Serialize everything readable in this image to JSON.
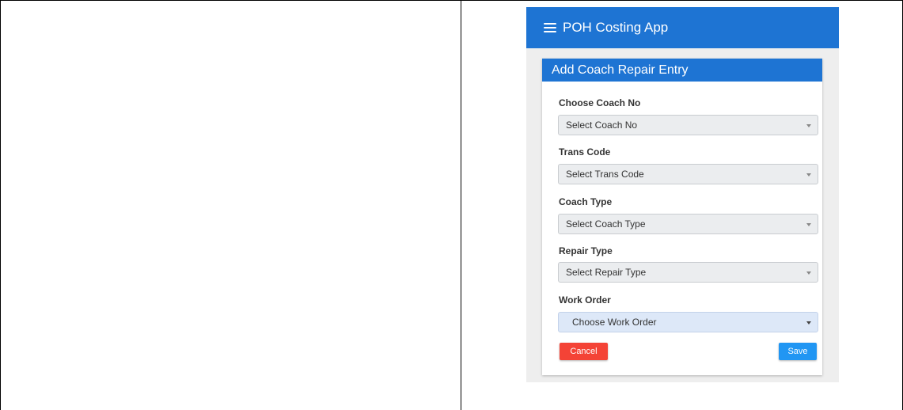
{
  "app": {
    "title": "POH Costing App"
  },
  "card": {
    "title": "Add Coach Repair Entry"
  },
  "fields": [
    {
      "label": "Choose Coach No",
      "placeholder": "Select Coach No"
    },
    {
      "label": "Trans Code",
      "placeholder": "Select Trans Code"
    },
    {
      "label": "Coach Type",
      "placeholder": "Select Coach Type"
    },
    {
      "label": "Repair Type",
      "placeholder": "Select Repair Type"
    },
    {
      "label": "Work Order",
      "placeholder": "Choose Work Order"
    }
  ],
  "buttons": {
    "cancel": "Cancel",
    "save": "Save"
  },
  "colors": {
    "appbar": "#1e74d3",
    "cancel": "#f44336",
    "save": "#2196f3"
  },
  "icons": {
    "menu": "menu-icon",
    "dropdown": "chevron-down-icon"
  }
}
